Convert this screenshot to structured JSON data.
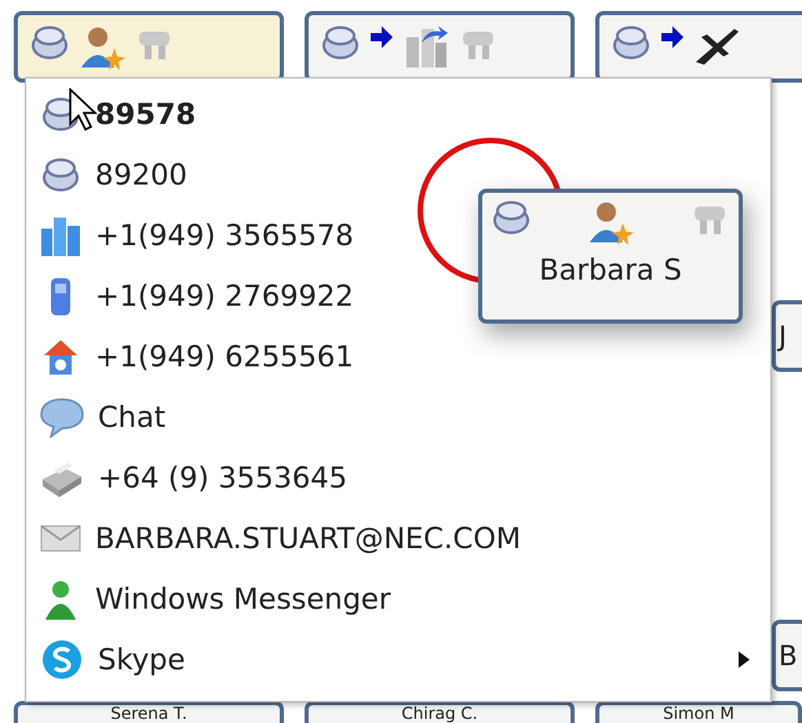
{
  "contact_cards": [
    {
      "selected": true,
      "kind": "person"
    },
    {
      "selected": false,
      "kind": "office-forward"
    },
    {
      "selected": false,
      "kind": "travel-forward"
    }
  ],
  "side_cards": [
    {
      "text": "J"
    },
    {
      "text": "B"
    }
  ],
  "bottom_cards": [
    {
      "name": "Serena T."
    },
    {
      "name": "Chirag C."
    },
    {
      "name": "Simon M"
    }
  ],
  "menu": {
    "items": [
      {
        "kind": "phone",
        "label": "89578",
        "default": true,
        "submenu": false
      },
      {
        "kind": "phone",
        "label": "89200",
        "default": false,
        "submenu": false
      },
      {
        "kind": "office",
        "label": "+1(949) 3565578",
        "default": false,
        "submenu": false
      },
      {
        "kind": "mobile",
        "label": "+1(949) 2769922",
        "default": false,
        "submenu": false
      },
      {
        "kind": "home",
        "label": "+1(949) 6255561",
        "default": false,
        "submenu": false
      },
      {
        "kind": "chat",
        "label": "Chat",
        "default": false,
        "submenu": false
      },
      {
        "kind": "fax",
        "label": "+64 (9) 3553645",
        "default": false,
        "submenu": false
      },
      {
        "kind": "email",
        "label": "BARBARA.STUART@NEC.COM",
        "default": false,
        "submenu": false
      },
      {
        "kind": "messenger",
        "label": "Windows Messenger",
        "default": false,
        "submenu": false
      },
      {
        "kind": "skype",
        "label": "Skype",
        "default": false,
        "submenu": true
      }
    ]
  },
  "popup_card": {
    "name": "Barbara S",
    "kind": "person"
  }
}
